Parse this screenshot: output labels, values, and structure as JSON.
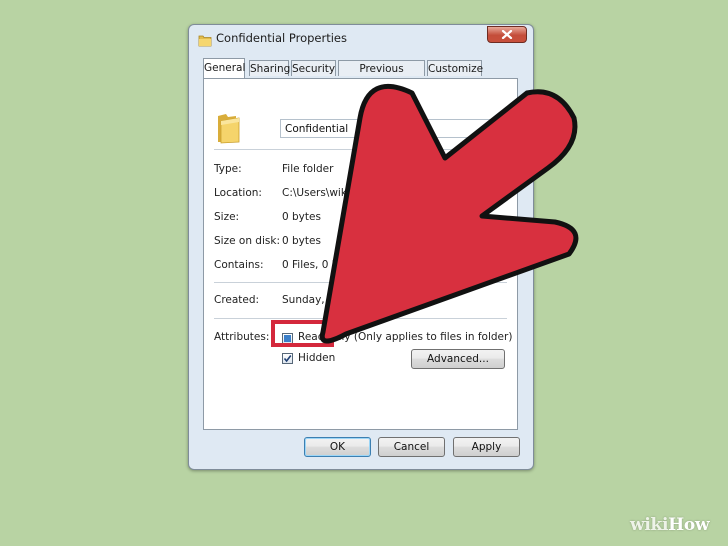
{
  "window": {
    "title": "Confidential Properties",
    "close_icon": "close-icon"
  },
  "tabs": [
    {
      "label": "General",
      "active": true
    },
    {
      "label": "Sharing",
      "active": false
    },
    {
      "label": "Security",
      "active": false
    },
    {
      "label": "Previous Versions",
      "active": false
    },
    {
      "label": "Customize",
      "active": false
    }
  ],
  "general": {
    "folder_name": "Confidential",
    "fields": [
      {
        "label": "Type:",
        "value": "File folder"
      },
      {
        "label": "Location:",
        "value": "C:\\Users\\wikiHow\\Deskt"
      },
      {
        "label": "Size:",
        "value": "0 bytes"
      },
      {
        "label": "Size on disk:",
        "value": "0 bytes"
      },
      {
        "label": "Contains:",
        "value": "0 Files, 0 Folders"
      },
      {
        "label": "Created:",
        "value": "Sunday, March"
      }
    ],
    "attributes_label": "Attributes:",
    "readonly_label": "Read-only (Only applies to files in folder)",
    "readonly_state": "indeterminate",
    "hidden_label": "Hidden",
    "hidden_checked": true,
    "advanced_label": "Advanced..."
  },
  "buttons": {
    "ok": "OK",
    "cancel": "Cancel",
    "apply": "Apply"
  },
  "annotation": {
    "highlight_color": "#d4283c",
    "arrow_color": "#d8303f"
  },
  "watermark": {
    "prefix": "wiki",
    "suffix": "How"
  }
}
